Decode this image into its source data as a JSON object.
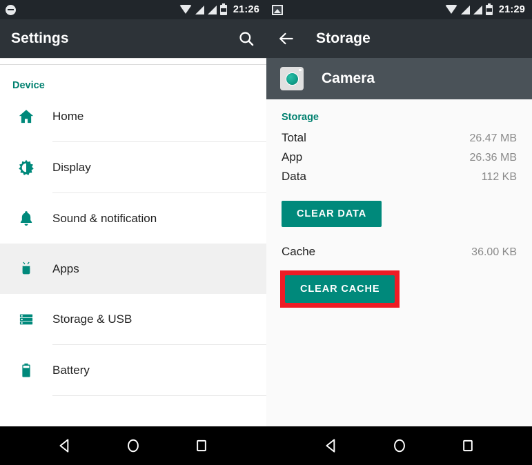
{
  "left_screen": {
    "status_bar": {
      "icons": [
        "do-not-disturb-icon",
        "wifi-icon",
        "signal-icon",
        "signal-icon",
        "battery-icon"
      ],
      "time": "21:26"
    },
    "app_bar": {
      "title": "Settings",
      "action_icon": "search-icon"
    },
    "section": {
      "header": "Device"
    },
    "items": [
      {
        "label": "Home",
        "icon": "home-icon",
        "selected": false
      },
      {
        "label": "Display",
        "icon": "brightness-icon",
        "selected": false
      },
      {
        "label": "Sound & notification",
        "icon": "bell-icon",
        "selected": false
      },
      {
        "label": "Apps",
        "icon": "android-icon",
        "selected": true
      },
      {
        "label": "Storage & USB",
        "icon": "storage-icon",
        "selected": false
      },
      {
        "label": "Battery",
        "icon": "battery-icon",
        "selected": false
      }
    ]
  },
  "right_screen": {
    "status_bar": {
      "icons": [
        "screenshot-icon",
        "wifi-icon",
        "signal-icon",
        "signal-icon",
        "battery-icon"
      ],
      "time": "21:29"
    },
    "app_bar": {
      "title": "Storage",
      "back_icon": "back-arrow-icon"
    },
    "app_header": {
      "name": "Camera",
      "icon": "camera-app-icon"
    },
    "storage": {
      "section_title": "Storage",
      "rows": [
        {
          "label": "Total",
          "value": "26.47 MB"
        },
        {
          "label": "App",
          "value": "26.36 MB"
        },
        {
          "label": "Data",
          "value": "112 KB"
        }
      ],
      "clear_data_label": "CLEAR DATA",
      "cache": {
        "label": "Cache",
        "value": "36.00 KB"
      },
      "clear_cache_label": "CLEAR CACHE"
    }
  },
  "nav_bar": {
    "buttons": [
      "back-triangle-icon",
      "home-circle-icon",
      "recents-square-icon"
    ]
  },
  "colors": {
    "accent_teal": "#00897b",
    "section_teal": "#00806f",
    "app_bar_dark": "#2d3338",
    "status_bar_dark": "#21262b",
    "app_header_slate": "#4a5258",
    "highlight_red": "#ee1c25",
    "selected_row_gray": "#f0f0f0"
  }
}
